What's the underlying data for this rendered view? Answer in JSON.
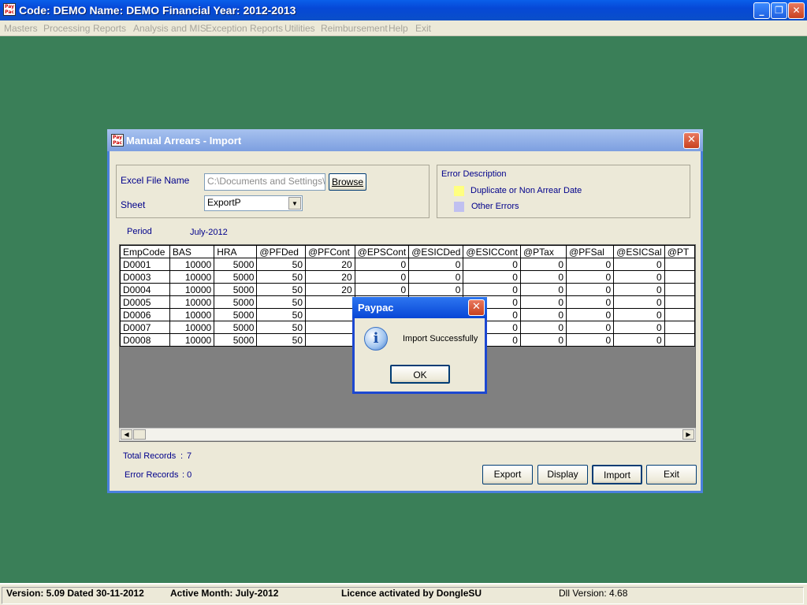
{
  "app": {
    "title": "Code: DEMO Name: DEMO Financial Year: 2012-2013",
    "icon_text": "Pay Pac",
    "minimize": "_",
    "restore": "❐",
    "close": "✕"
  },
  "menu": [
    "Masters",
    "Processing",
    "Reports",
    "Analysis and MIS",
    "Exception Reports",
    "Utilities",
    "Reimbursement",
    "Help",
    "Exit"
  ],
  "dialog": {
    "title": "Manual Arrears - Import",
    "close": "✕",
    "excel_label": "Excel File Name",
    "excel_value": "C:\\Documents and Settings\\Sy",
    "browse": "Browse",
    "sheet_label": "Sheet",
    "sheet_value": "ExportP",
    "error_group_title": "Error Description",
    "error_dup": "Duplicate or Non Arrear Date",
    "error_other": "Other Errors",
    "error_dup_color": "#ffff80",
    "error_other_color": "#c0c0f0",
    "period_label": "Period",
    "period_value": "July-2012",
    "total_label": "Total Records",
    "total_sep": ":",
    "total_value": "7",
    "error_label": "Error Records",
    "error_value": ": 0",
    "buttons": {
      "export": "Export",
      "display": "Display",
      "import": "Import",
      "exit": "Exit"
    }
  },
  "grid": {
    "columns": [
      "EmpCode",
      "BAS",
      "HRA",
      "@PFDed",
      "@PFCont",
      "@EPSCont",
      "@ESICDed",
      "@ESICCont",
      "@PTax",
      "@PFSal",
      "@ESICSal",
      "@PT"
    ],
    "rows": [
      [
        "D0001",
        "10000",
        "5000",
        "50",
        "20",
        "0",
        "0",
        "0",
        "0",
        "0",
        "0",
        ""
      ],
      [
        "D0003",
        "10000",
        "5000",
        "50",
        "20",
        "0",
        "0",
        "0",
        "0",
        "0",
        "0",
        ""
      ],
      [
        "D0004",
        "10000",
        "5000",
        "50",
        "20",
        "0",
        "0",
        "0",
        "0",
        "0",
        "0",
        ""
      ],
      [
        "D0005",
        "10000",
        "5000",
        "50",
        "",
        "",
        "",
        "0",
        "0",
        "0",
        "0",
        ""
      ],
      [
        "D0006",
        "10000",
        "5000",
        "50",
        "",
        "",
        "",
        "0",
        "0",
        "0",
        "0",
        ""
      ],
      [
        "D0007",
        "10000",
        "5000",
        "50",
        "",
        "",
        "",
        "0",
        "0",
        "0",
        "0",
        ""
      ],
      [
        "D0008",
        "10000",
        "5000",
        "50",
        "",
        "",
        "",
        "0",
        "0",
        "0",
        "0",
        ""
      ]
    ]
  },
  "msgbox": {
    "title": "Paypac",
    "message": "Import Successfully",
    "ok": "OK",
    "close": "✕",
    "icon": "i"
  },
  "status": {
    "version": "Version: 5.09 Dated 30-11-2012",
    "active_month": "Active Month: July-2012",
    "licence": "Licence activated by DongleSU",
    "dll": "Dll Version: 4.68"
  }
}
